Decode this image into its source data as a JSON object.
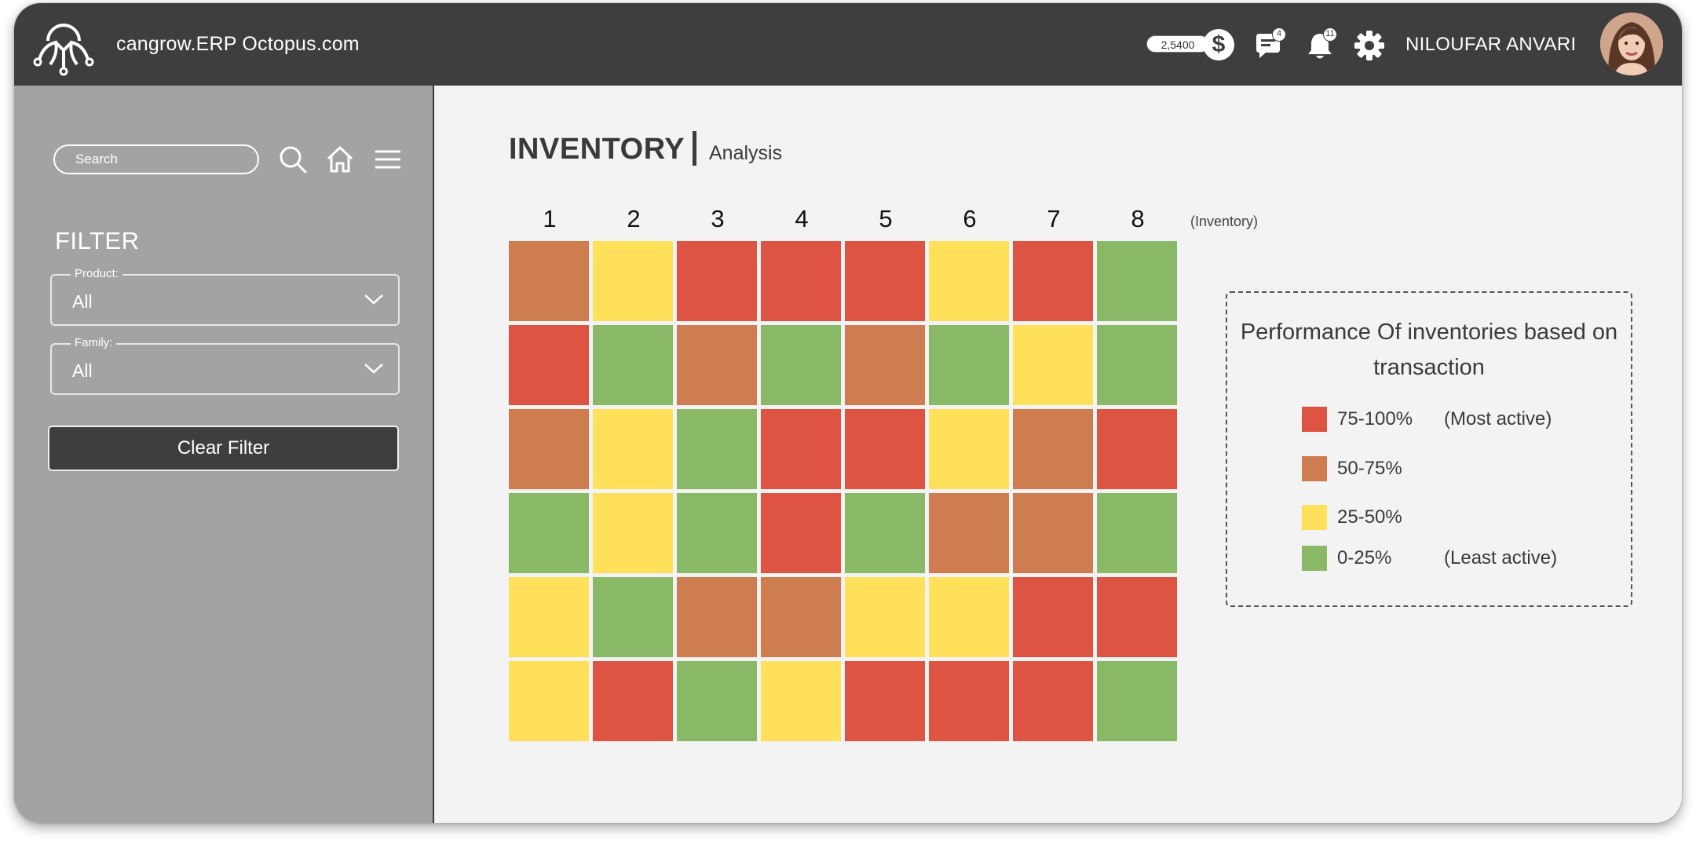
{
  "app": {
    "title": "cangrow.ERP Octopus.com",
    "credit": "2,5400",
    "credit_symbol": "$",
    "messages_count": "4",
    "notifications_count": "11",
    "user_name": "NILOUFAR ANVARI"
  },
  "sidebar": {
    "search_placeholder": "Search",
    "filter_title": "FILTER",
    "product_label": "Product:",
    "product_value": "All",
    "family_label": "Family:",
    "family_value": "All",
    "clear_label": "Clear Filter"
  },
  "main": {
    "title": "INVENTORY",
    "subtitle": "Analysis",
    "unit_label": "(Inventory)"
  },
  "chart_data": {
    "type": "heatmap",
    "columns": [
      "1",
      "2",
      "3",
      "4",
      "5",
      "6",
      "7",
      "8"
    ],
    "rows": [
      [
        "50-75%",
        "25-50%",
        "75-100%",
        "75-100%",
        "75-100%",
        "25-50%",
        "75-100%",
        "0-25%"
      ],
      [
        "75-100%",
        "0-25%",
        "50-75%",
        "0-25%",
        "50-75%",
        "0-25%",
        "25-50%",
        "0-25%"
      ],
      [
        "50-75%",
        "25-50%",
        "0-25%",
        "75-100%",
        "75-100%",
        "25-50%",
        "50-75%",
        "75-100%"
      ],
      [
        "0-25%",
        "25-50%",
        "0-25%",
        "75-100%",
        "0-25%",
        "50-75%",
        "50-75%",
        "0-25%"
      ],
      [
        "25-50%",
        "0-25%",
        "50-75%",
        "50-75%",
        "25-50%",
        "25-50%",
        "75-100%",
        "75-100%"
      ],
      [
        "25-50%",
        "75-100%",
        "0-25%",
        "25-50%",
        "75-100%",
        "75-100%",
        "75-100%",
        "0-25%"
      ]
    ],
    "legend": {
      "title": "Performance Of inventories based on transaction",
      "items": [
        {
          "range": "75-100%",
          "note": "(Most active)",
          "color": "#dd5442"
        },
        {
          "range": "50-75%",
          "note": "",
          "color": "#cd7d4f"
        },
        {
          "range": "25-50%",
          "note": "",
          "color": "#ffe05b"
        },
        {
          "range": "0-25%",
          "note": "(Least active)",
          "color": "#89b866"
        }
      ]
    }
  }
}
